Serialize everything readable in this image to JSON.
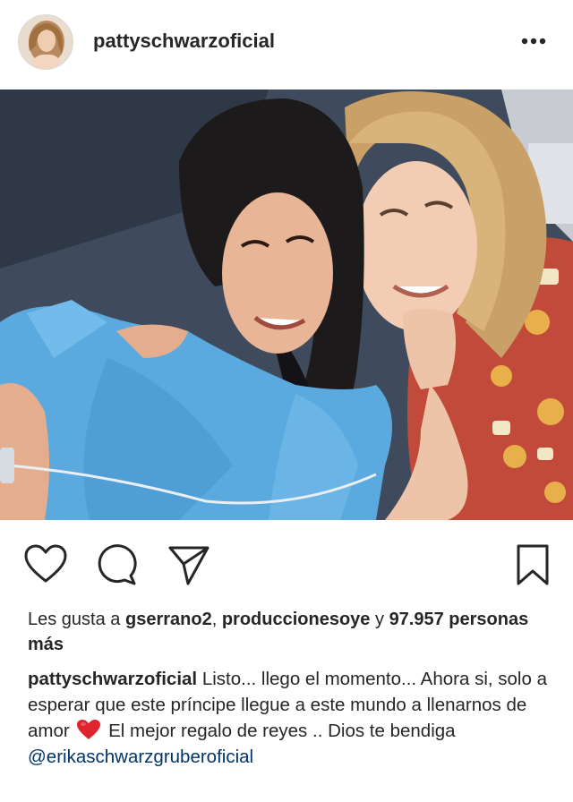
{
  "post": {
    "username": "pattyschwarzoficial",
    "more_icon": "more-options-icon",
    "actions": {
      "like_icon": "heart-icon",
      "comment_icon": "comment-icon",
      "share_icon": "send-icon",
      "save_icon": "bookmark-icon"
    },
    "likes": {
      "prefix": "Les gusta a",
      "user1": "gserrano2",
      "separator": ",",
      "user2": "produccionesoye",
      "conjunction": "y",
      "count": "97.957",
      "suffix": "personas más"
    },
    "caption": {
      "username": "pattyschwarzoficial",
      "text_before_emoji": "Listo... llego el momento... Ahora si, solo a esperar que este príncipe llegue a este mundo a llenarnos de amor",
      "emoji": "red-heart-emoji",
      "text_after_emoji": "El mejor regalo de reyes .. Dios te bendiga",
      "mention": "@erikaschwarzgruberoficial"
    }
  },
  "colors": {
    "text": "#262626",
    "mention": "#003569",
    "border": "#dbdbdb",
    "heart_emoji": "#e0242e"
  }
}
